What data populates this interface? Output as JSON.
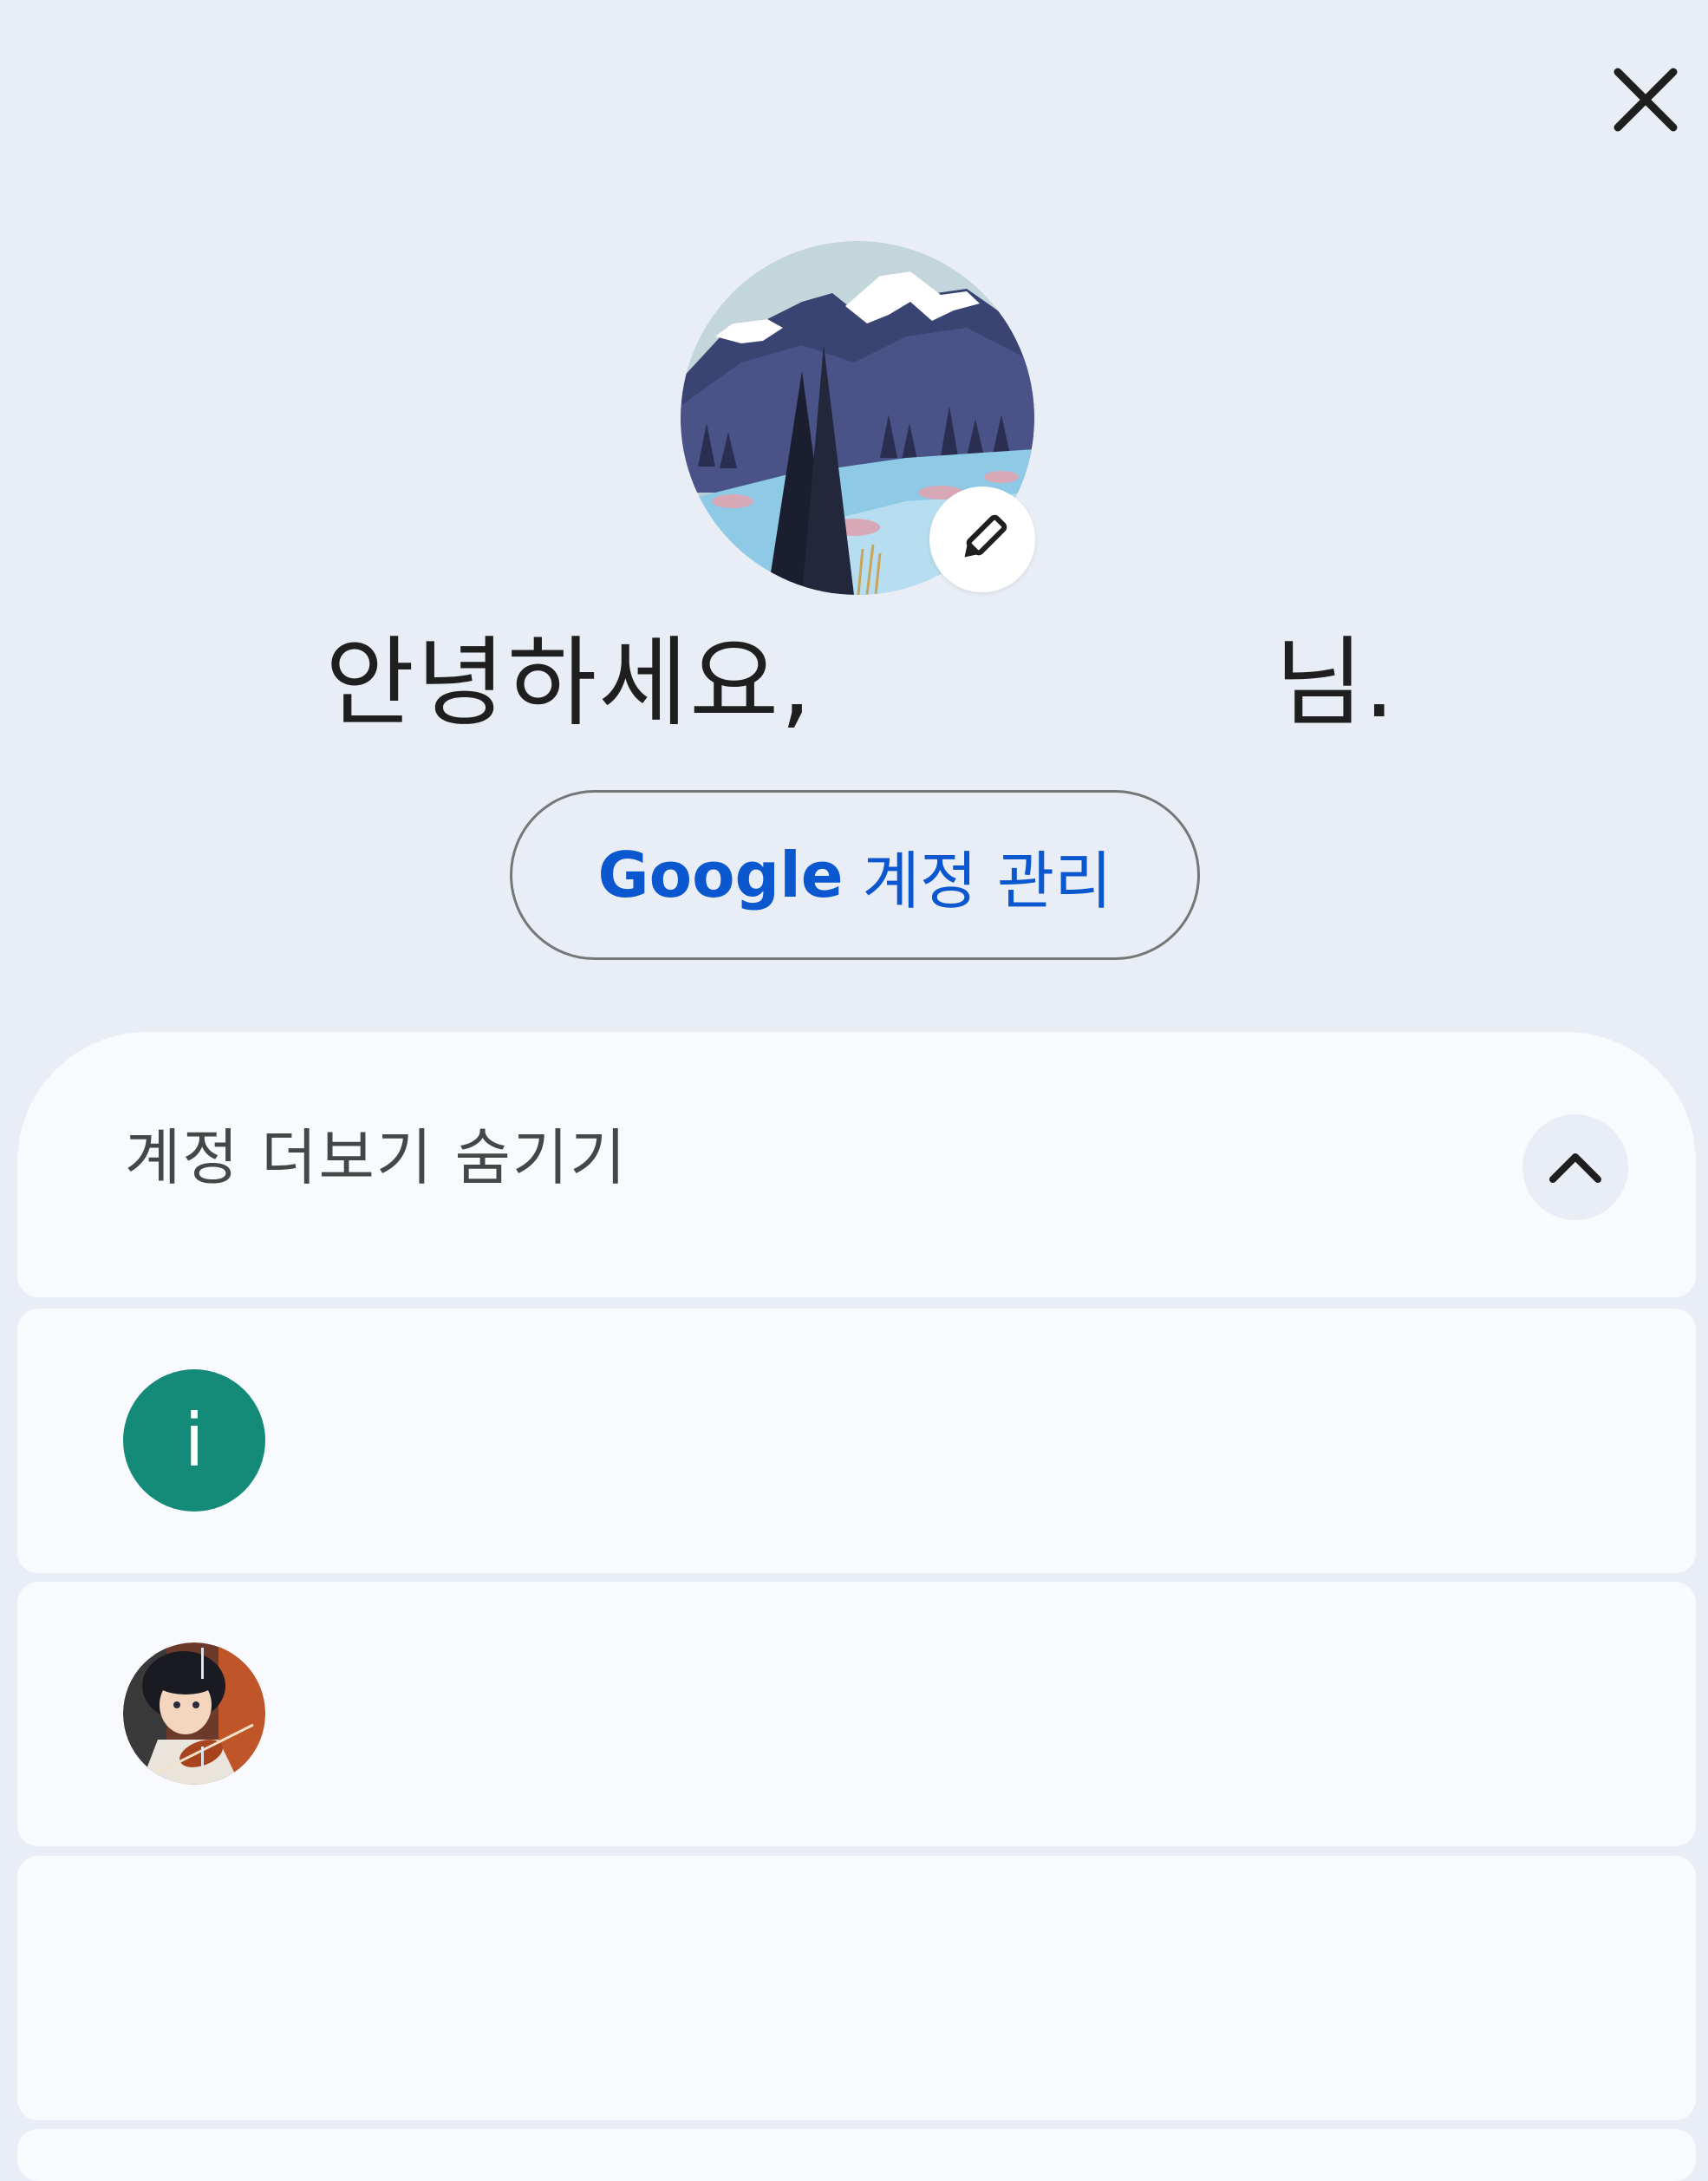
{
  "header": {
    "close_icon": "close-icon"
  },
  "profile": {
    "avatar_icon": "mountain-landscape-avatar",
    "edit_icon": "pencil-icon",
    "greeting_prefix": "안녕하세요,",
    "greeting_suffix": "님.",
    "manage_brand": "Google",
    "manage_label": "계정 관리"
  },
  "accounts": {
    "toggle_label": "계정 더보기 숨기기",
    "toggle_icon": "chevron-up-icon",
    "items": [
      {
        "avatar_letter": "i",
        "avatar_color": "#148a78"
      },
      {
        "avatar_icon": "anime-violinist-avatar"
      }
    ]
  },
  "colors": {
    "background": "#e9eef6",
    "surface": "#f8fafd",
    "accent": "#0b57d0"
  }
}
